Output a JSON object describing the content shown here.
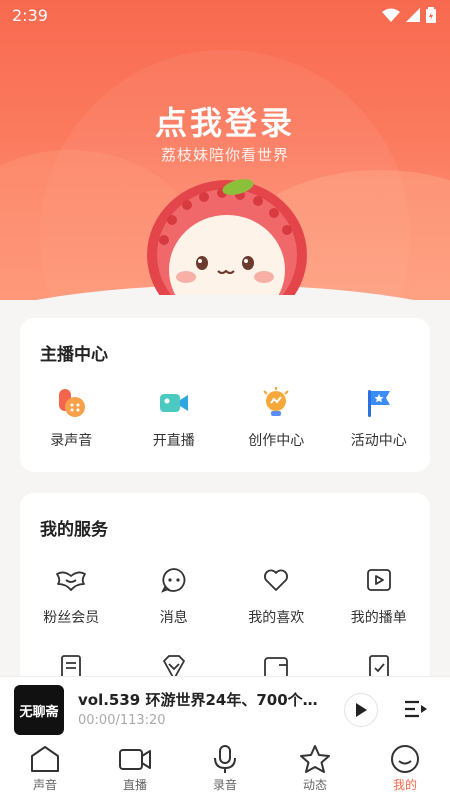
{
  "status_bar": {
    "time": "2:39"
  },
  "header": {
    "title": "点我登录",
    "subtitle": "荔枝妹陪你看世界"
  },
  "anchor_center": {
    "title": "主播中心",
    "items": [
      {
        "label": "录声音",
        "icon": "record-voice-icon"
      },
      {
        "label": "开直播",
        "icon": "live-camera-icon"
      },
      {
        "label": "创作中心",
        "icon": "lightbulb-icon"
      },
      {
        "label": "活动中心",
        "icon": "flag-icon"
      }
    ]
  },
  "services": {
    "title": "我的服务",
    "items": [
      {
        "label": "粉丝会员",
        "icon": "fan-member-icon"
      },
      {
        "label": "消息",
        "icon": "message-icon"
      },
      {
        "label": "我的喜欢",
        "icon": "heart-icon"
      },
      {
        "label": "我的播单",
        "icon": "playlist-icon"
      }
    ]
  },
  "player": {
    "cover_text": "无聊斋",
    "title": "vol.539 环游世界24年、700个目...",
    "time": "00:00/113:20"
  },
  "nav": {
    "items": [
      {
        "label": "声音",
        "icon": "home-icon"
      },
      {
        "label": "直播",
        "icon": "video-icon"
      },
      {
        "label": "录音",
        "icon": "microphone-icon"
      },
      {
        "label": "动态",
        "icon": "star-icon"
      },
      {
        "label": "我的",
        "icon": "profile-icon",
        "active": true
      }
    ]
  },
  "colors": {
    "accent": "#f5674b",
    "header": "#f86a50"
  }
}
